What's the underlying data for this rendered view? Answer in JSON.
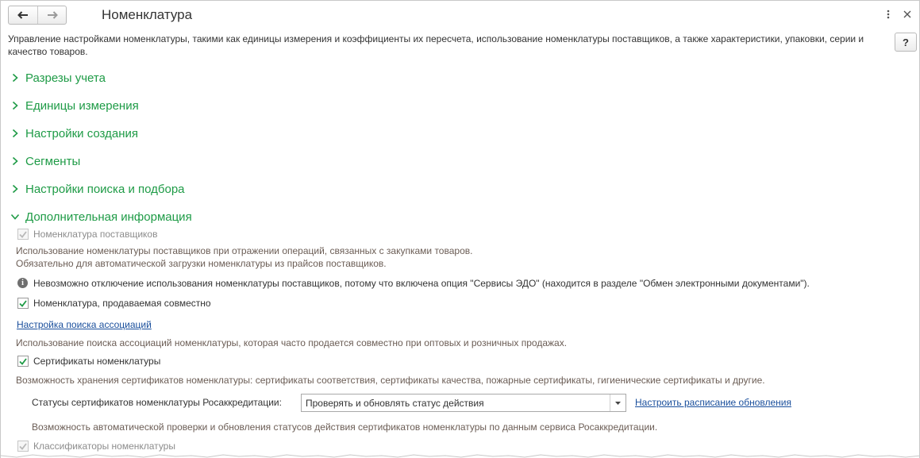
{
  "window": {
    "title": "Номенклатура",
    "back_icon": "arrow-left-icon",
    "forward_icon": "arrow-right-icon",
    "more_icon": "more-vertical-icon",
    "close_icon": "close-icon",
    "help_label": "?"
  },
  "description": "Управление настройками номенклатуры, такими как единицы измерения и коэффициенты их пересчета, использование номенклатуры поставщиков, а также характеристики, упаковки, серии и качество товаров.",
  "sections": [
    {
      "label": "Разрезы учета",
      "expanded": false
    },
    {
      "label": "Единицы измерения",
      "expanded": false
    },
    {
      "label": "Настройки создания",
      "expanded": false
    },
    {
      "label": "Сегменты",
      "expanded": false
    },
    {
      "label": "Настройки поиска и подбора",
      "expanded": false
    },
    {
      "label": "Дополнительная информация",
      "expanded": true
    }
  ],
  "additional": {
    "supplier_nomenclature": {
      "label": "Номенклатура поставщиков",
      "checked": true,
      "disabled": true,
      "hint_line1": "Использование номенклатуры поставщиков при отражении операций, связанных с закупками товаров.",
      "hint_line2": "Обязательно для автоматической загрузки номенклатуры из прайсов поставщиков."
    },
    "info_message": "Невозможно отключение использования номенклатуры поставщиков, потому что включена опция \"Сервисы ЭДО\" (находится в разделе \"Обмен электронными документами\").",
    "sold_together": {
      "label": "Номенклатура, продаваемая совместно",
      "checked": true,
      "link": "Настройка поиска ассоциаций",
      "hint": "Использование поиска ассоциаций номенклатуры, которая часто продается совместно при оптовых и розничных продажах."
    },
    "certificates": {
      "label": "Сертификаты номенклатуры",
      "checked": true,
      "hint": "Возможность хранения сертификатов номенклатуры: сертификаты соответствия, сертификаты качества, пожарные сертификаты, гигиенические сертификаты и другие.",
      "status_label": "Статусы сертификатов номенклатуры Росаккредитации:",
      "status_value": "Проверять и обновлять статус действия",
      "schedule_link": "Настроить расписание обновления",
      "status_hint": "Возможность автоматической проверки и обновления статусов действия сертификатов номенклатуры по данным сервиса Росаккредитации."
    },
    "classifiers": {
      "label": "Классификаторы номенклатуры",
      "checked": true,
      "disabled": true
    }
  },
  "colors": {
    "section_green": "#1e9b46",
    "link_blue": "#1a4f9c",
    "hint_brown": "#6b5d55"
  }
}
